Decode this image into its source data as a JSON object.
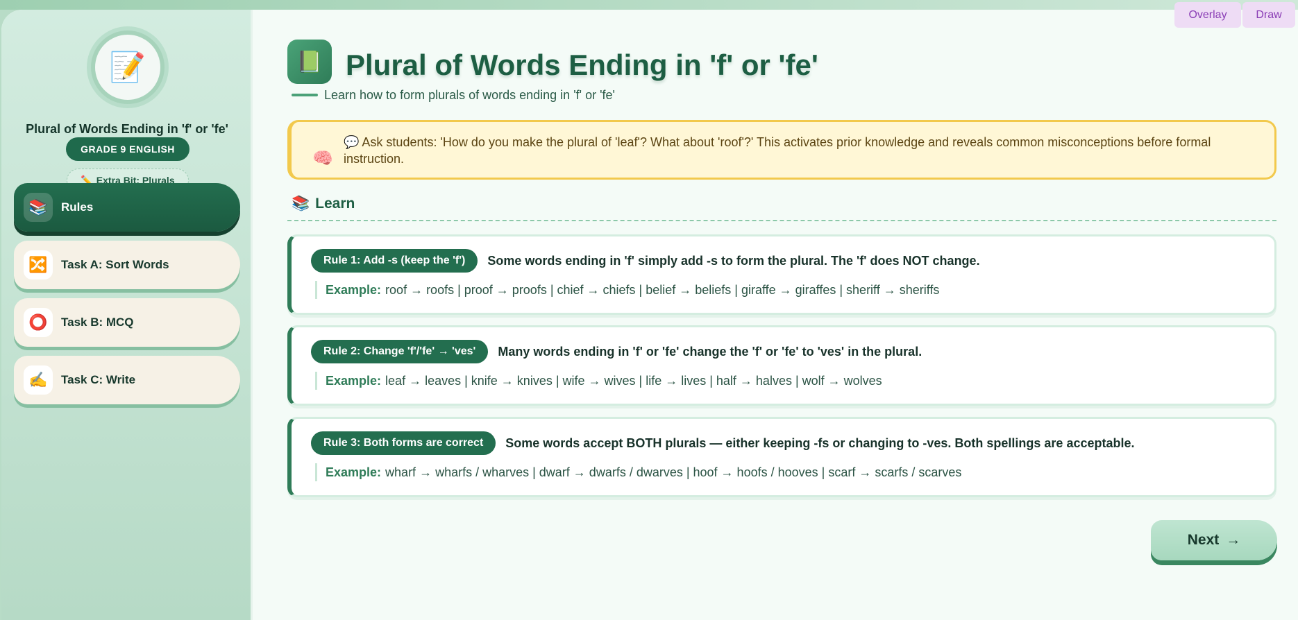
{
  "toolbar": {
    "overlay_label": "Overlay",
    "draw_label": "Draw"
  },
  "sidebar": {
    "avatar_icon": "pencil-paper-icon",
    "title": "Plural of Words Ending in 'f' or 'fe'",
    "grade": "GRADE 9 ENGLISH",
    "extra": "Extra Bit: Plurals",
    "items": [
      {
        "label": "Rules",
        "icon": "books-icon",
        "glyph": "📚",
        "active": true
      },
      {
        "label": "Task A: Sort Words",
        "icon": "shuffle-icon",
        "glyph": "🔀",
        "active": false
      },
      {
        "label": "Task B: MCQ",
        "icon": "circle-icon",
        "glyph": "⭕",
        "active": false
      },
      {
        "label": "Task C: Write",
        "icon": "writing-hand-icon",
        "glyph": "✍️",
        "active": false
      }
    ]
  },
  "main": {
    "title": "Plural of Words Ending in 'f' or 'fe'",
    "subtitle": "Learn how to form plurals of words ending in 'f' or 'fe'",
    "note": "💬 Ask students: 'How do you make the plural of 'leaf'? What about 'roof'?' This activates prior knowledge and reveals common misconceptions before formal instruction.",
    "section": "Learn",
    "example_label": "Example:",
    "rules": [
      {
        "pill": "Rule 1: Add -s (keep the 'f')",
        "desc": "Some words ending in 'f' simply add -s to form the plural. The 'f' does NOT change.",
        "example": "roof → roofs | proof → proofs | chief → chiefs | belief → beliefs | giraffe → giraffes | sheriff → sheriffs"
      },
      {
        "pill": "Rule 2: Change 'f'/'fe' → 'ves'",
        "desc": "Many words ending in 'f' or 'fe' change the 'f' or 'fe' to 'ves' in the plural.",
        "example": "leaf → leaves | knife → knives | wife → wives | life → lives | half → halves | wolf → wolves"
      },
      {
        "pill": "Rule 3: Both forms are correct",
        "desc": "Some words accept BOTH plurals — either keeping -fs or changing to -ves. Both spellings are acceptable.",
        "example": "wharf → wharfs / wharves | dwarf → dwarfs / dwarves | hoof → hoofs / hooves | scarf → scarfs / scarves"
      }
    ],
    "next_label": "Next",
    "next_arrow": "→"
  }
}
